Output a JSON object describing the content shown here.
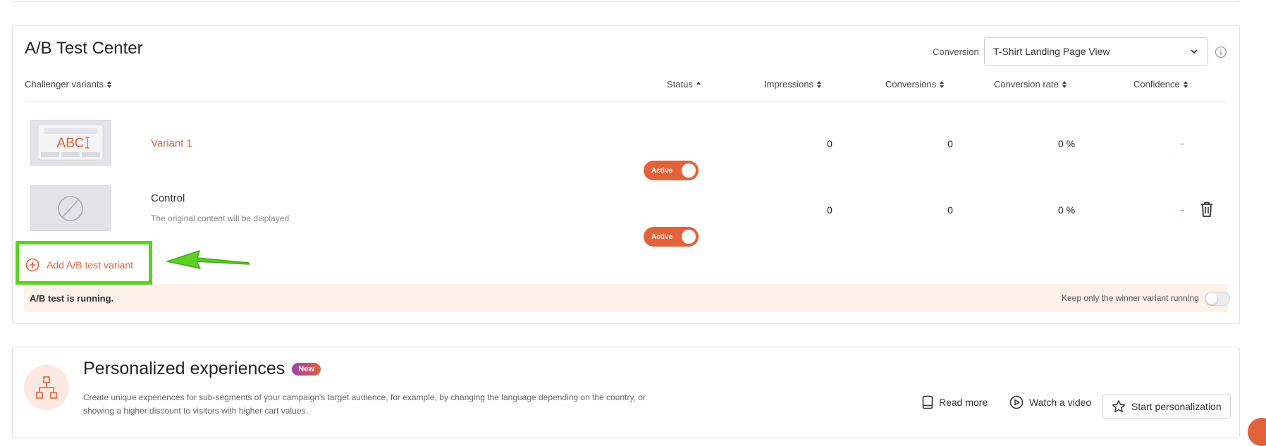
{
  "ab_test": {
    "title": "A/B Test Center",
    "conversion_label": "Conversion",
    "conversion_value": "T-Shirt Landing Page View",
    "columns": {
      "variants": "Challenger variants",
      "status": "Status",
      "impressions": "Impressions",
      "conversions": "Conversions",
      "conversion_rate": "Conversion rate",
      "confidence": "Confidence"
    },
    "rows": [
      {
        "name": "Variant 1",
        "thumb_text": "ABC",
        "status": "Active",
        "impressions": "0",
        "conversions": "0",
        "conversion_rate": "0 %",
        "confidence": "-"
      },
      {
        "name": "Control",
        "description": "The original content will be displayed.",
        "status": "Active",
        "impressions": "0",
        "conversions": "0",
        "conversion_rate": "0 %",
        "confidence": "-"
      }
    ],
    "add_variant_label": "Add A/B test variant",
    "status_message": "A/B test is running.",
    "keep_winner_label": "Keep only the winner variant running"
  },
  "personalized": {
    "title": "Personalized experiences",
    "badge": "New",
    "description": "Create unique experiences for sub-segments of your campaign's target audience, for example, by changing the language depending on the country, or showing a higher discount to visitors with higher cart values.",
    "read_more": "Read more",
    "watch_video": "Watch a video",
    "start": "Start personalization"
  },
  "colors": {
    "accent": "#e2633a",
    "highlight": "#5ed024",
    "link": "#3a7bd5",
    "status_bg": "#fdf1ea"
  }
}
